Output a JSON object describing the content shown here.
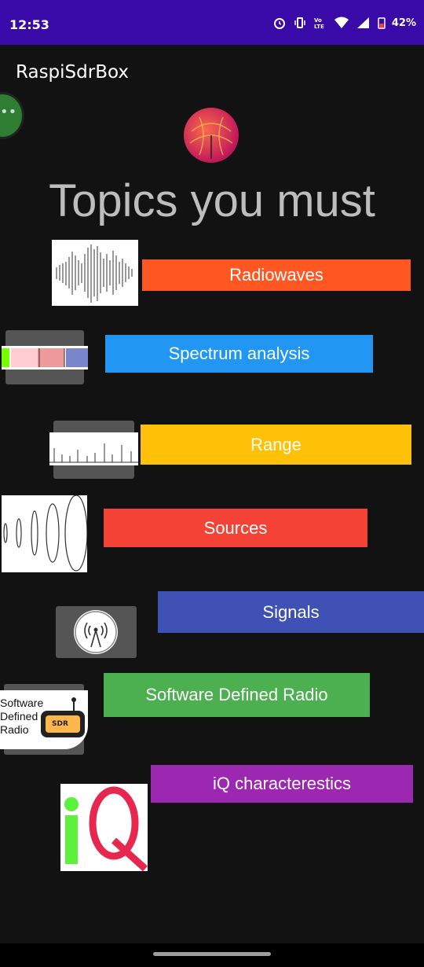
{
  "status": {
    "time": "12:53",
    "battery": "42%"
  },
  "app": {
    "title": "RaspiSdrBox"
  },
  "headline": "Topics you must",
  "topics": [
    {
      "label": "Radiowaves",
      "color": "#ff5722",
      "icon": "radiowave-thumbnail"
    },
    {
      "label": "Spectrum analysis",
      "color": "#2196f3",
      "icon": "spectrum-thumbnail"
    },
    {
      "label": "Range",
      "color": "#ffc107",
      "icon": "range-thumbnail"
    },
    {
      "label": "Sources",
      "color": "#f44336",
      "icon": "sources-thumbnail"
    },
    {
      "label": "Signals",
      "color": "#3f51b5",
      "icon": "antenna-icon"
    },
    {
      "label": "Software Defined Radio",
      "color": "#4caf50",
      "icon": "sdr-thumbnail"
    },
    {
      "label": "iQ characterestics",
      "color": "#9c27b0",
      "icon": "iq-thumbnail"
    }
  ],
  "sdr_thumb_text": {
    "line1": "Software",
    "line2": "Defined",
    "line3": "Radio",
    "badge": "SDR"
  }
}
